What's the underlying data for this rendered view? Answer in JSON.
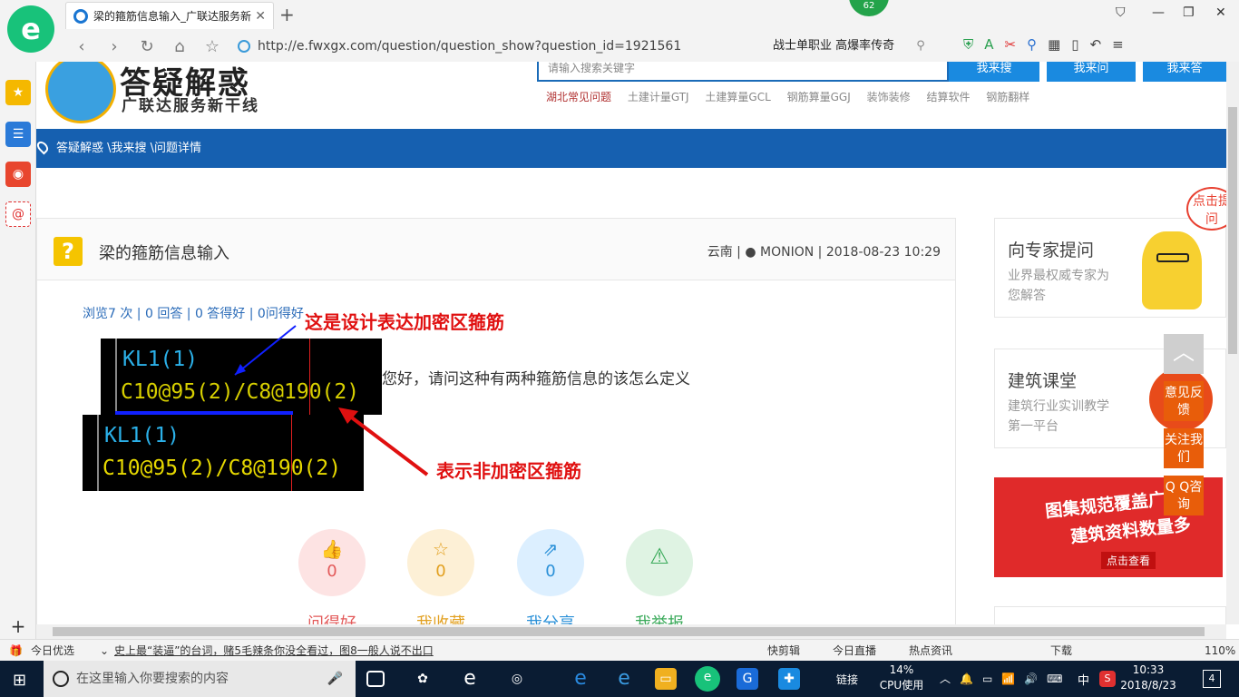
{
  "browser": {
    "tab_title": "梁的箍筋信息输入_广联达服务新",
    "badge": "62",
    "url": "http://e.fwxgx.com/question/question_show?question_id=1921561",
    "search_text": "战士单职业 高爆率传奇"
  },
  "site": {
    "name": "答疑解惑",
    "slogan": "广联达服务新干线",
    "search_placeholder": "请输入搜索关键字",
    "btn_search": "我来搜",
    "btn_ask": "我来问",
    "btn_answer": "我来答",
    "categories": [
      "湖北常见问题",
      "土建计量GTJ",
      "土建算量GCL",
      "钢筋算量GGJ",
      "装饰装修",
      "结算软件",
      "钢筋翻样"
    ],
    "breadcrumb": "答疑解惑 \\我来搜 \\问题详情"
  },
  "question": {
    "title": "梁的箍筋信息输入",
    "region": "云南",
    "user": "MONION",
    "datetime": "2018-08-23 10:29",
    "stats": "浏览7 次 | 0 回答 | 0 答得好 | 0问得好",
    "text": "您好，请问这种有两种箍筋信息的该怎么定义",
    "img1": {
      "line1": "KL1(1)",
      "line2": "C10@95(2)/C8@190(2)"
    },
    "img2": {
      "line1": "KL1(1)",
      "line2": "C10@95(2)/C8@190(2)"
    },
    "annotation_top": "这是设计表达加密区箍筋",
    "annotation_bottom": "表示非加密区箍筋"
  },
  "actions": [
    {
      "label": "问得好",
      "count": "0",
      "color": "#e35a5a",
      "bg": "#fde3e3"
    },
    {
      "label": "我收藏",
      "count": "0",
      "color": "#e2a020",
      "bg": "#fdf0d6"
    },
    {
      "label": "我分享",
      "count": "0",
      "color": "#2a90d8",
      "bg": "#dcefff"
    },
    {
      "label": "我举报",
      "count": "",
      "color": "#3aaa5a",
      "bg": "#dff3e3"
    }
  ],
  "right": {
    "expert_title": "向专家提问",
    "expert_sub": "业界最权威专家为您解答",
    "course_title": "建筑课堂",
    "course_sub": "建筑行业实训教学第一平台",
    "ad_line1": "图集规范覆盖广",
    "ad_line2": "建筑资料数量多",
    "ad_btn": "点击查看",
    "bubble": "点击提问"
  },
  "float": {
    "feedback": "意见反馈",
    "follow": "关注我们",
    "qq": "Q Q咨询"
  },
  "statusbar": {
    "left": "今日优选",
    "news": "史上最“装逼”的台词，赌5毛辣条你没全看过，图8一般人说不出口",
    "items": [
      "快剪辑",
      "今日直播",
      "热点资讯",
      "下载"
    ],
    "zoom": "110%"
  },
  "taskbar": {
    "search_placeholder": "在这里输入你要搜索的内容",
    "link": "链接",
    "cpu_percent": "14%",
    "cpu_label": "CPU使用",
    "ime": "中",
    "time": "10:33",
    "date": "2018/8/23",
    "notif": "4"
  }
}
